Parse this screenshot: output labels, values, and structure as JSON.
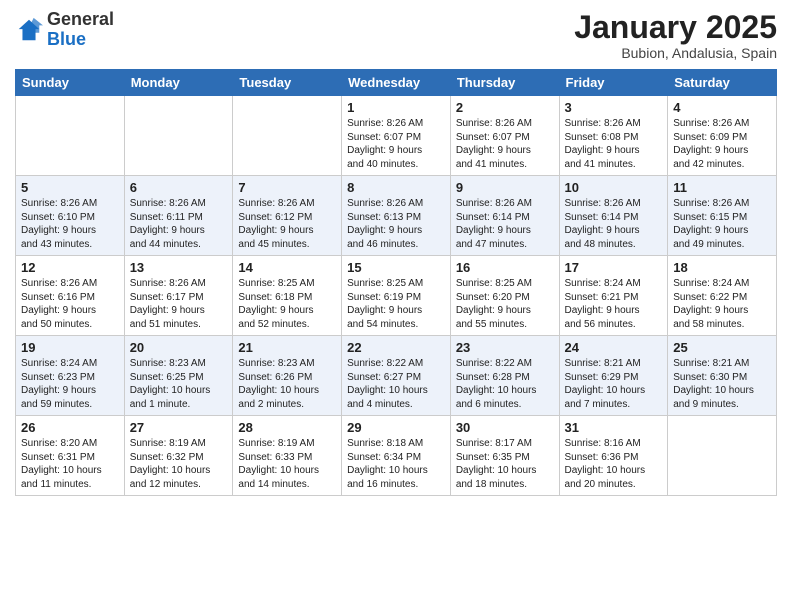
{
  "logo": {
    "general": "General",
    "blue": "Blue"
  },
  "header": {
    "month": "January 2025",
    "location": "Bubion, Andalusia, Spain"
  },
  "days_of_week": [
    "Sunday",
    "Monday",
    "Tuesday",
    "Wednesday",
    "Thursday",
    "Friday",
    "Saturday"
  ],
  "weeks": [
    [
      {
        "day": "",
        "info": ""
      },
      {
        "day": "",
        "info": ""
      },
      {
        "day": "",
        "info": ""
      },
      {
        "day": "1",
        "info": "Sunrise: 8:26 AM\nSunset: 6:07 PM\nDaylight: 9 hours\nand 40 minutes."
      },
      {
        "day": "2",
        "info": "Sunrise: 8:26 AM\nSunset: 6:07 PM\nDaylight: 9 hours\nand 41 minutes."
      },
      {
        "day": "3",
        "info": "Sunrise: 8:26 AM\nSunset: 6:08 PM\nDaylight: 9 hours\nand 41 minutes."
      },
      {
        "day": "4",
        "info": "Sunrise: 8:26 AM\nSunset: 6:09 PM\nDaylight: 9 hours\nand 42 minutes."
      }
    ],
    [
      {
        "day": "5",
        "info": "Sunrise: 8:26 AM\nSunset: 6:10 PM\nDaylight: 9 hours\nand 43 minutes."
      },
      {
        "day": "6",
        "info": "Sunrise: 8:26 AM\nSunset: 6:11 PM\nDaylight: 9 hours\nand 44 minutes."
      },
      {
        "day": "7",
        "info": "Sunrise: 8:26 AM\nSunset: 6:12 PM\nDaylight: 9 hours\nand 45 minutes."
      },
      {
        "day": "8",
        "info": "Sunrise: 8:26 AM\nSunset: 6:13 PM\nDaylight: 9 hours\nand 46 minutes."
      },
      {
        "day": "9",
        "info": "Sunrise: 8:26 AM\nSunset: 6:14 PM\nDaylight: 9 hours\nand 47 minutes."
      },
      {
        "day": "10",
        "info": "Sunrise: 8:26 AM\nSunset: 6:14 PM\nDaylight: 9 hours\nand 48 minutes."
      },
      {
        "day": "11",
        "info": "Sunrise: 8:26 AM\nSunset: 6:15 PM\nDaylight: 9 hours\nand 49 minutes."
      }
    ],
    [
      {
        "day": "12",
        "info": "Sunrise: 8:26 AM\nSunset: 6:16 PM\nDaylight: 9 hours\nand 50 minutes."
      },
      {
        "day": "13",
        "info": "Sunrise: 8:26 AM\nSunset: 6:17 PM\nDaylight: 9 hours\nand 51 minutes."
      },
      {
        "day": "14",
        "info": "Sunrise: 8:25 AM\nSunset: 6:18 PM\nDaylight: 9 hours\nand 52 minutes."
      },
      {
        "day": "15",
        "info": "Sunrise: 8:25 AM\nSunset: 6:19 PM\nDaylight: 9 hours\nand 54 minutes."
      },
      {
        "day": "16",
        "info": "Sunrise: 8:25 AM\nSunset: 6:20 PM\nDaylight: 9 hours\nand 55 minutes."
      },
      {
        "day": "17",
        "info": "Sunrise: 8:24 AM\nSunset: 6:21 PM\nDaylight: 9 hours\nand 56 minutes."
      },
      {
        "day": "18",
        "info": "Sunrise: 8:24 AM\nSunset: 6:22 PM\nDaylight: 9 hours\nand 58 minutes."
      }
    ],
    [
      {
        "day": "19",
        "info": "Sunrise: 8:24 AM\nSunset: 6:23 PM\nDaylight: 9 hours\nand 59 minutes."
      },
      {
        "day": "20",
        "info": "Sunrise: 8:23 AM\nSunset: 6:25 PM\nDaylight: 10 hours\nand 1 minute."
      },
      {
        "day": "21",
        "info": "Sunrise: 8:23 AM\nSunset: 6:26 PM\nDaylight: 10 hours\nand 2 minutes."
      },
      {
        "day": "22",
        "info": "Sunrise: 8:22 AM\nSunset: 6:27 PM\nDaylight: 10 hours\nand 4 minutes."
      },
      {
        "day": "23",
        "info": "Sunrise: 8:22 AM\nSunset: 6:28 PM\nDaylight: 10 hours\nand 6 minutes."
      },
      {
        "day": "24",
        "info": "Sunrise: 8:21 AM\nSunset: 6:29 PM\nDaylight: 10 hours\nand 7 minutes."
      },
      {
        "day": "25",
        "info": "Sunrise: 8:21 AM\nSunset: 6:30 PM\nDaylight: 10 hours\nand 9 minutes."
      }
    ],
    [
      {
        "day": "26",
        "info": "Sunrise: 8:20 AM\nSunset: 6:31 PM\nDaylight: 10 hours\nand 11 minutes."
      },
      {
        "day": "27",
        "info": "Sunrise: 8:19 AM\nSunset: 6:32 PM\nDaylight: 10 hours\nand 12 minutes."
      },
      {
        "day": "28",
        "info": "Sunrise: 8:19 AM\nSunset: 6:33 PM\nDaylight: 10 hours\nand 14 minutes."
      },
      {
        "day": "29",
        "info": "Sunrise: 8:18 AM\nSunset: 6:34 PM\nDaylight: 10 hours\nand 16 minutes."
      },
      {
        "day": "30",
        "info": "Sunrise: 8:17 AM\nSunset: 6:35 PM\nDaylight: 10 hours\nand 18 minutes."
      },
      {
        "day": "31",
        "info": "Sunrise: 8:16 AM\nSunset: 6:36 PM\nDaylight: 10 hours\nand 20 minutes."
      },
      {
        "day": "",
        "info": ""
      }
    ]
  ]
}
